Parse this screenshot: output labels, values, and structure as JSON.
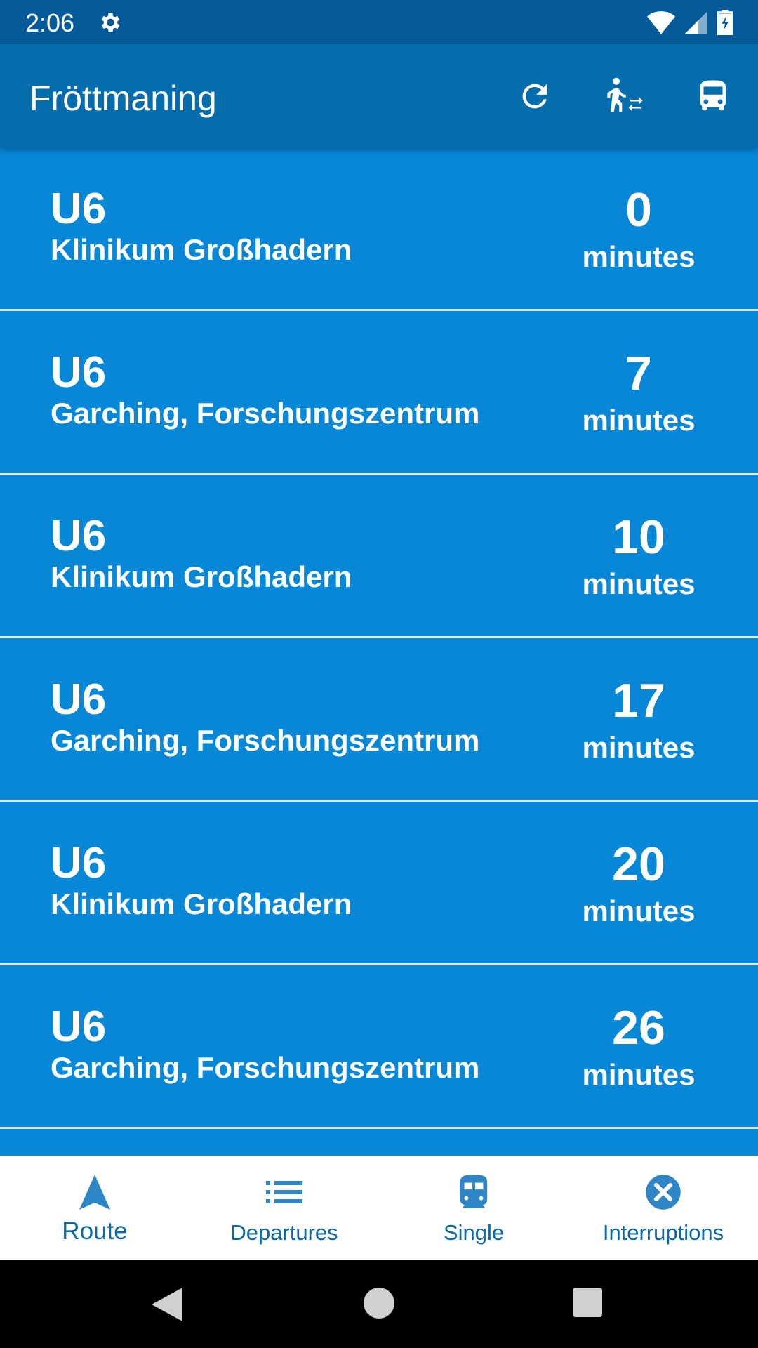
{
  "status": {
    "time": "2:06"
  },
  "appbar": {
    "title": "Fröttmaning"
  },
  "departures": [
    {
      "line": "U6",
      "destination": "Klinikum Großhadern",
      "minutes": "0",
      "unit": "minutes"
    },
    {
      "line": "U6",
      "destination": "Garching, Forschungszentrum",
      "minutes": "7",
      "unit": "minutes"
    },
    {
      "line": "U6",
      "destination": "Klinikum Großhadern",
      "minutes": "10",
      "unit": "minutes"
    },
    {
      "line": "U6",
      "destination": "Garching, Forschungszentrum",
      "minutes": "17",
      "unit": "minutes"
    },
    {
      "line": "U6",
      "destination": "Klinikum Großhadern",
      "minutes": "20",
      "unit": "minutes"
    },
    {
      "line": "U6",
      "destination": "Garching, Forschungszentrum",
      "minutes": "26",
      "unit": "minutes"
    }
  ],
  "bottom_nav": [
    {
      "label": "Route",
      "icon": "navigation-arrow-icon",
      "active": true
    },
    {
      "label": "Departures",
      "icon": "list-icon",
      "active": false
    },
    {
      "label": "Single",
      "icon": "train-icon",
      "active": false
    },
    {
      "label": "Interruptions",
      "icon": "cancel-circle-icon",
      "active": false
    }
  ],
  "colors": {
    "statusbar": "#045a99",
    "appbar": "#066dad",
    "row_background": "#0787d6",
    "row_divider": "#d7ecf9",
    "nav_accent": "#0a6aa8"
  }
}
